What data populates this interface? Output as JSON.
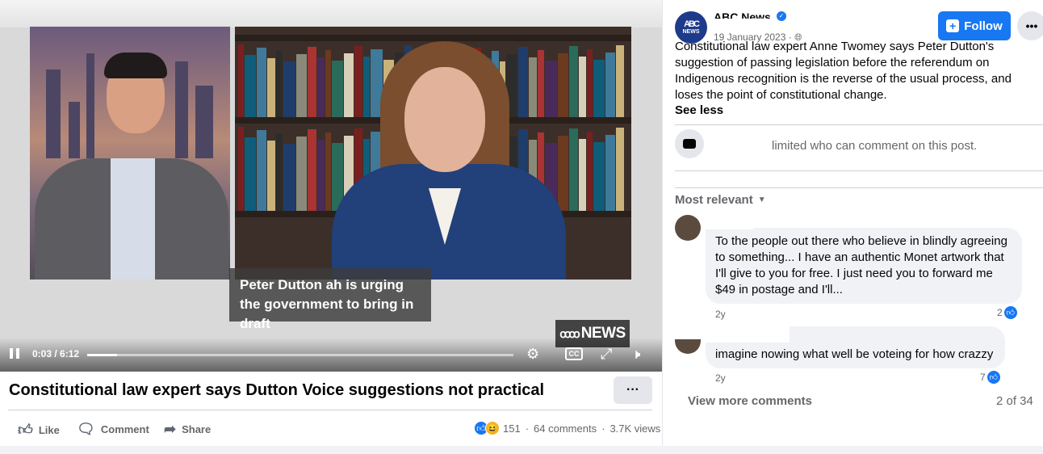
{
  "video": {
    "caption": "Peter Dutton ah is urging the government to bring in draft",
    "badge": "NEWS",
    "time": "0:03 / 6:12",
    "progress_fraction": 0.07
  },
  "post": {
    "title": "Constitutional law expert says Dutton Voice suggestions not practical",
    "actions": {
      "like": "Like",
      "comment": "Comment",
      "share": "Share"
    },
    "stats": {
      "reactions": "151",
      "comments": "64 comments",
      "views": "3.7K views",
      "separator": "·"
    }
  },
  "page": {
    "name": "ABC News",
    "avatar_text_top": "ABC",
    "avatar_text_bottom": "NEWS",
    "date": "19 January 2023 ·",
    "follow_label": "Follow",
    "more_label": "•••"
  },
  "description": "Constitutional law expert Anne Twomey says Peter Dutton's suggestion of passing legislation before the referendum on Indigenous recognition is the reverse of the usual process, and loses the point of constitutional change.",
  "see_less": "See less",
  "limited": "limited who can comment on this post.",
  "sort_label": "Most relevant",
  "comments": [
    {
      "text": "To the people out there who believe in blindly agreeing to something... I have an authentic Monet artwork that I'll give to you for free. I just need you to forward me $49 in postage and I'll...",
      "time": "2y",
      "likes": "2"
    },
    {
      "text": "imagine nowing what well be voteing for how crazzy",
      "time": "2y",
      "likes": "7"
    }
  ],
  "footer": {
    "view_more": "View more comments",
    "count": "2 of 34"
  },
  "colors": {
    "accent": "#1877f2",
    "muted_text": "#65676b",
    "bubble": "#f0f2f5"
  }
}
